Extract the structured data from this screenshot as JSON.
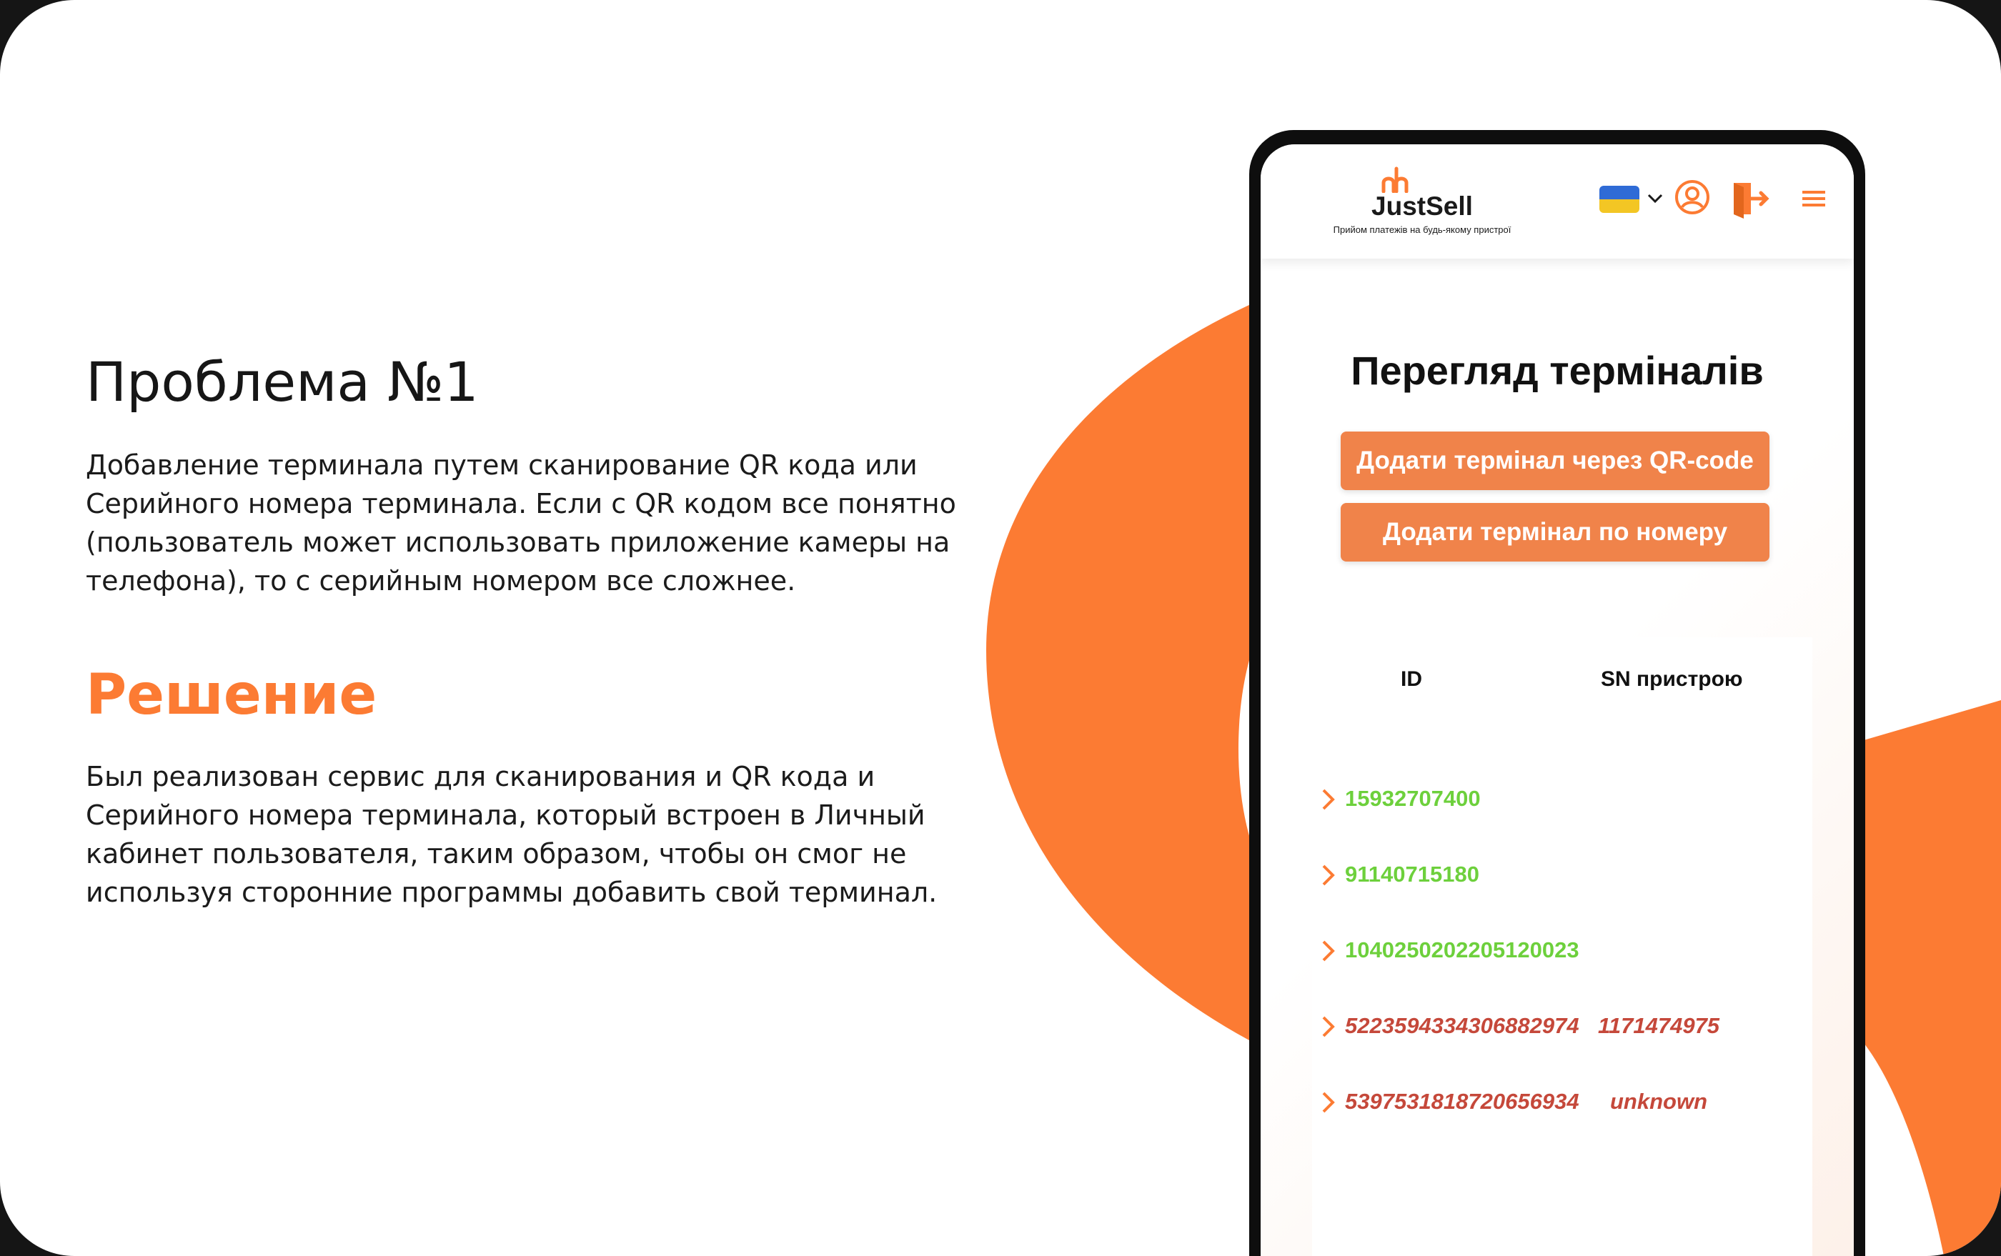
{
  "slide": {
    "problem_title": "Проблема №1",
    "problem_text": "Добавление терминала путем сканирование QR кода или Серийного номера терминала. Если с QR кодом все понятно (пользователь может использовать приложение камеры на телефона), то с серийным номером все сложнее.",
    "solution_title": "Решение",
    "solution_text": "Был реализован сервис для сканирования и QR кода и Серийного номера терминала, который встроен в Личный кабинет пользователя, таким образом, чтобы он смог не используя сторонние программы добавить свой терминал."
  },
  "app": {
    "logo_text": "JustSell",
    "logo_tagline": "Прийом платежів на будь-якому пристрої",
    "language_flag": "ukraine-flag",
    "page_title": "Перегляд терміналів",
    "buttons": {
      "add_by_qr": "Додати термінал через QR-code",
      "add_by_number": "Додати термінал по номеру"
    },
    "table": {
      "headers": {
        "id": "ID",
        "sn": "SN пристрою"
      },
      "rows": [
        {
          "id": "15932707400",
          "sn": "",
          "status": "ok"
        },
        {
          "id": "91140715180",
          "sn": "",
          "status": "ok"
        },
        {
          "id": "1040250202205120023",
          "sn": "",
          "status": "ok"
        },
        {
          "id": "5223594334306882974",
          "sn": "1171474975",
          "status": "error"
        },
        {
          "id": "5397531818720656934",
          "sn": "unknown",
          "status": "error"
        }
      ]
    }
  },
  "colors": {
    "accent": "#fc7b33",
    "button": "#f0834a",
    "ok_text": "#6dd03c",
    "error_text": "#c5483a"
  }
}
